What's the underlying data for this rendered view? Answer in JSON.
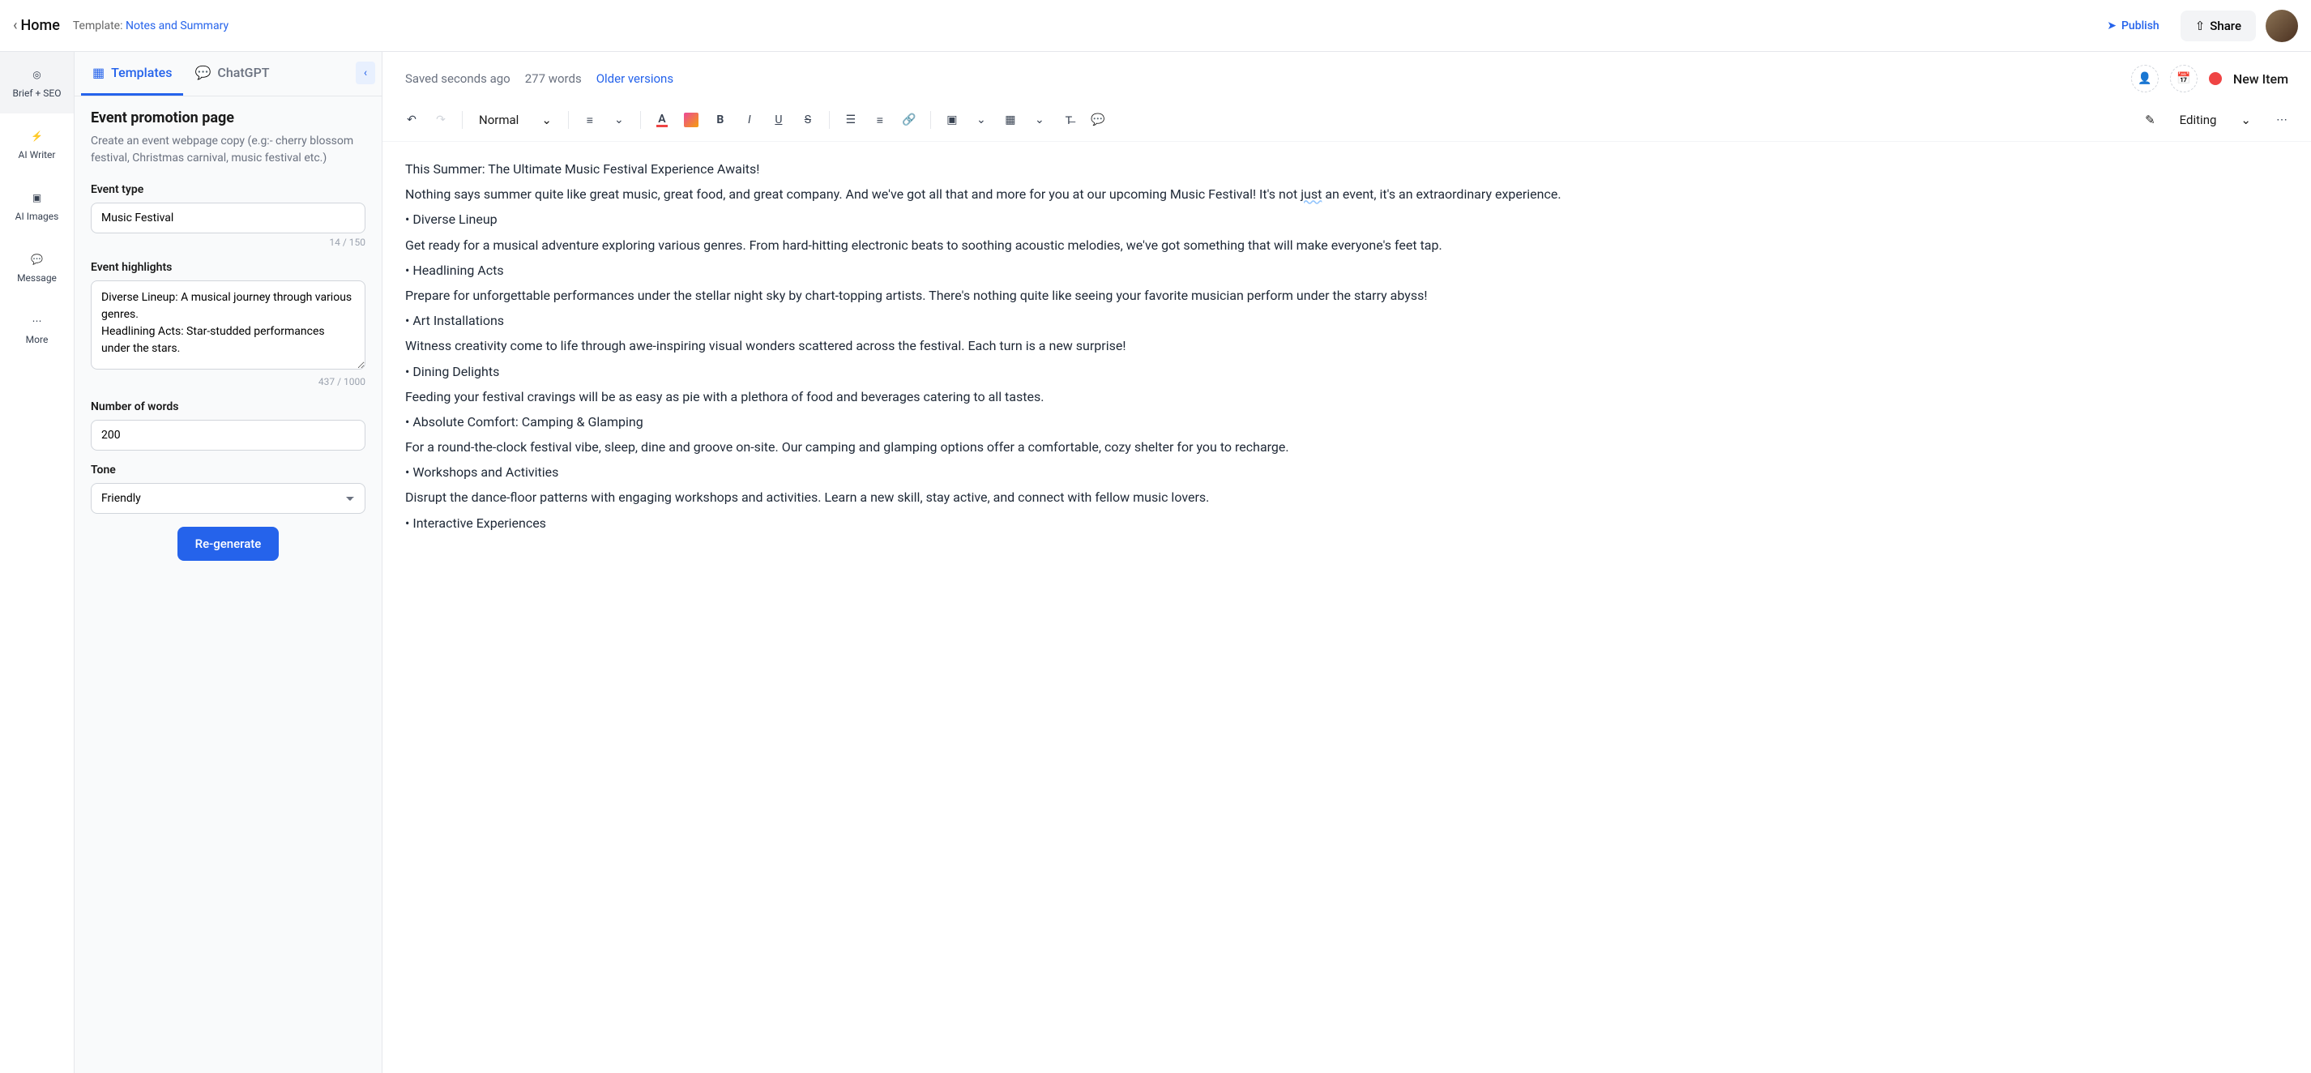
{
  "header": {
    "home": "Home",
    "template_prefix": "Template: ",
    "template_name": "Notes and Summary",
    "publish": "Publish",
    "share": "Share"
  },
  "nav": {
    "brief": "Brief + SEO",
    "writer": "AI Writer",
    "images": "AI Images",
    "message": "Message",
    "more": "More"
  },
  "tabs": {
    "templates": "Templates",
    "chatgpt": "ChatGPT"
  },
  "form": {
    "title": "Event promotion page",
    "desc": "Create an event webpage copy (e.g:- cherry blossom festival, Christmas carnival, music festival etc.)",
    "type_label": "Event type",
    "type_value": "Music Festival",
    "type_count": "14 / 150",
    "highlights_label": "Event highlights",
    "highlights_value": "Diverse Lineup: A musical journey through various genres.\nHeadlining Acts: Star-studded performances under the stars.",
    "highlights_count": "437 / 1000",
    "words_label": "Number of words",
    "words_value": "200",
    "tone_label": "Tone",
    "tone_value": "Friendly",
    "regenerate": "Re-generate"
  },
  "editor_header": {
    "saved": "Saved seconds ago",
    "wordcount": "277 words",
    "older": "Older versions",
    "status": "New Item"
  },
  "toolbar": {
    "style": "Normal",
    "mode": "Editing"
  },
  "content": {
    "p1": "This Summer: The Ultimate Music Festival Experience Awaits!",
    "p2a": "Nothing says summer quite like great music, great food, and great company. And we've got all that and more for you at our upcoming Music Festival! It's not ",
    "p2u": "just",
    "p2b": " an event, it's an extraordinary experience.",
    "b1": "• Diverse Lineup",
    "p3": "Get ready for a musical adventure exploring various genres. From hard-hitting electronic beats to soothing acoustic melodies, we've got something that will make everyone's feet tap.",
    "b2": "• Headlining Acts",
    "p4": "Prepare for unforgettable performances under the stellar night sky by chart-topping artists. There's nothing quite like seeing your favorite musician perform under the starry abyss!",
    "b3": "• Art Installations",
    "p5": "Witness creativity come to life through awe-inspiring visual wonders scattered across the festival. Each turn is a new surprise!",
    "b4": "• Dining Delights",
    "p6": "Feeding your festival cravings will be as easy as pie with a plethora of food and beverages catering to all tastes.",
    "b5": "• Absolute Comfort: Camping & Glamping",
    "p7": "For a round-the-clock festival vibe, sleep, dine and groove on-site. Our camping and glamping options offer a comfortable, cozy shelter for you to recharge.",
    "b6": "• Workshops and Activities",
    "p8": "Disrupt the dance-floor patterns with engaging workshops and activities. Learn a new skill, stay active, and connect with fellow music lovers.",
    "b7": "• Interactive Experiences"
  }
}
